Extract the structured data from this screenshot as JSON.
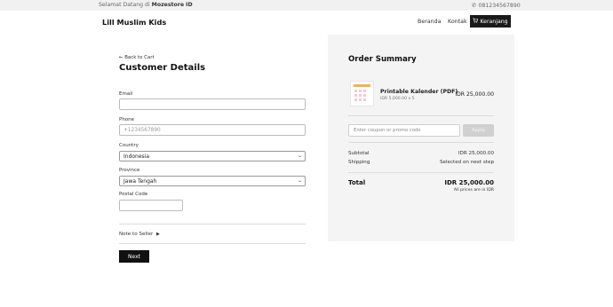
{
  "topbar": {
    "greeting_prefix": "Selamat Datang di",
    "store_name": "Mozestore ID",
    "phone": "081234567890"
  },
  "nav": {
    "brand": "Lill Muslim Kids",
    "links": [
      "Beranda",
      "Kontak"
    ],
    "cart_label": "Keranjang"
  },
  "form": {
    "back_label": "← Back to Cart",
    "title": "Customer Details",
    "email_label": "Email",
    "email_value": "",
    "phone_label": "Phone",
    "phone_placeholder": "+1234567890",
    "country_label": "Country",
    "country_value": "Indonesia",
    "province_label": "Province",
    "province_value": "Jawa Tengah",
    "postal_label": "Postal Code",
    "postal_value": "",
    "note_label": "Note to Seller",
    "next_label": "Next"
  },
  "summary": {
    "title": "Order Summary",
    "item": {
      "name": "Printable Kalender (PDF)",
      "qty_price": "IDR 5,000.00 x 5",
      "price": "IDR 25,000.00"
    },
    "coupon_placeholder": "Enter coupon or promo code",
    "apply_label": "Apply",
    "subtotal_label": "Subtotal",
    "subtotal_value": "IDR 25,000.00",
    "shipping_label": "Shipping",
    "shipping_value": "Selected on next step",
    "total_label": "Total",
    "total_value": "IDR 25,000.00",
    "currency_note": "All prices are in IDR"
  },
  "icons": {
    "phone": "phone-icon",
    "cart": "cart-icon",
    "chevron": "chevron-down-icon",
    "note_toggle": "caret-right-icon"
  },
  "colors": {
    "primary": "#111111",
    "summary_bg": "#f4f4f4",
    "topbar_bg": "#f1f1f1",
    "apply_disabled": "#d0d0d0"
  }
}
